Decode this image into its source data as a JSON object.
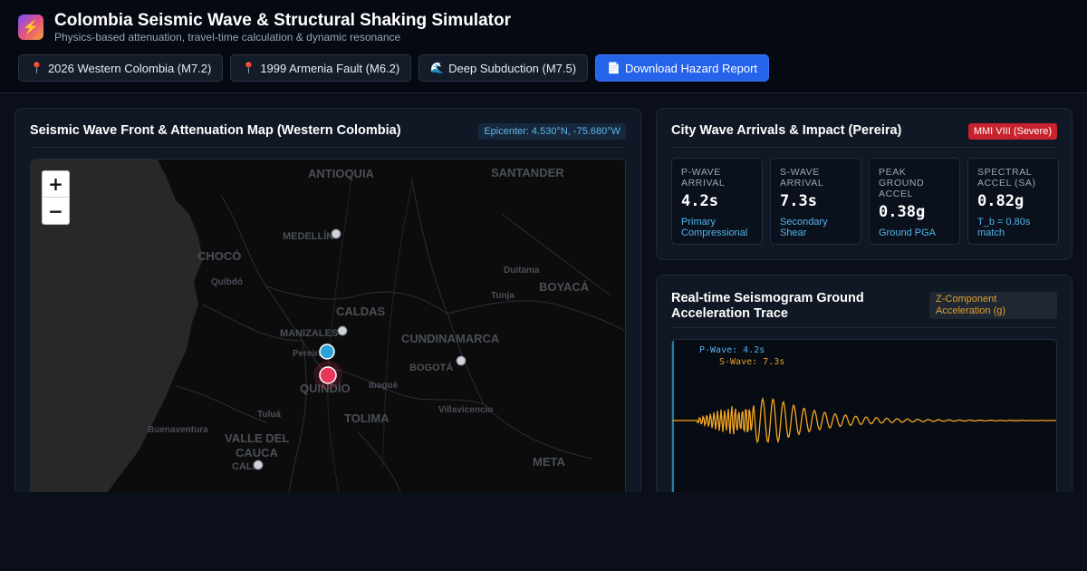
{
  "app": {
    "title": "Colombia Seismic Wave & Structural Shaking Simulator",
    "subtitle": "Physics-based attenuation, travel-time calculation & dynamic resonance",
    "logo_icon": "lightning-bolt-icon"
  },
  "scenarios": [
    {
      "icon": "map-pin-icon",
      "glyph": "📍",
      "label": "2026 Western Colombia (M7.2)"
    },
    {
      "icon": "map-pin-icon",
      "glyph": "📍",
      "label": "1999 Armenia Fault (M6.2)"
    },
    {
      "icon": "wave-icon",
      "glyph": "🌊",
      "label": "Deep Subduction (M7.5)"
    }
  ],
  "download_button": {
    "icon": "document-icon",
    "glyph": "📄",
    "label": "Download Hazard Report"
  },
  "map_panel": {
    "title": "Seismic Wave Front & Attenuation Map (Western Colombia)",
    "epicenter_badge": "Epicenter: 4.530°N, -75.680°W",
    "zoom_in": "+",
    "zoom_out": "−",
    "region_labels": [
      "ANTIOQUIA",
      "SANTANDER",
      "CHOCÓ",
      "BOYACÁ",
      "CALDAS",
      "CUNDINAMARCA",
      "QUINDÍO",
      "TOLIMA",
      "VALLE DEL",
      "CAUCA",
      "META"
    ],
    "city_labels": [
      "MEDELLÍN",
      "Quibdó",
      "Duitama",
      "Tunja",
      "MANIZALES",
      "Pereira",
      "BOGOTÁ",
      "Ibagué",
      "Tuluá",
      "Villavicencio",
      "Buenaventura",
      "CALI"
    ],
    "colors": {
      "epicenter": "#e8375a",
      "target_city": "#2aa3d6",
      "city": "#d0d4da"
    }
  },
  "impact_panel": {
    "title": "City Wave Arrivals & Impact (Pereira)",
    "mmi_badge": "MMI VIII (Severe)",
    "stats": [
      {
        "label": "P-Wave Arrival",
        "value": "4.2s",
        "note": "Primary Compressional"
      },
      {
        "label": "S-Wave Arrival",
        "value": "7.3s",
        "note": "Secondary Shear"
      },
      {
        "label": "Peak Ground Accel",
        "value": "0.38g",
        "note": "Ground PGA"
      },
      {
        "label": "Spectral Accel (SA)",
        "value": "0.82g",
        "note": "T_b = 0.80s match"
      }
    ]
  },
  "seismogram_panel": {
    "title": "Real-time Seismogram Ground Acceleration Trace",
    "component_badge": "Z-Component Acceleration (g)",
    "p_wave_tag": "P-Wave: 4.2s",
    "s_wave_tag": "S-Wave: 7.3s",
    "colors": {
      "trace": "#f4a623",
      "p_marker": "#2aa3d6"
    }
  }
}
